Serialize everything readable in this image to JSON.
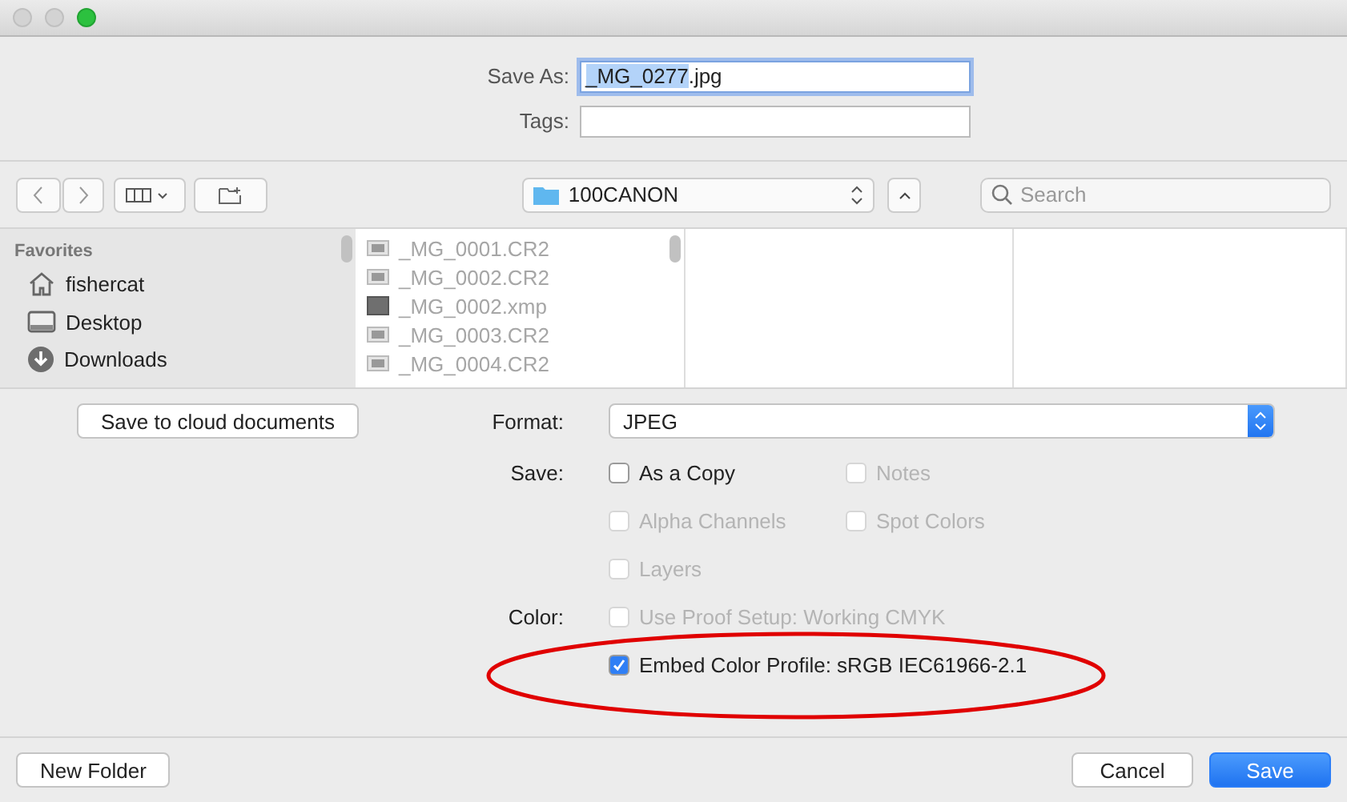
{
  "save_as": {
    "label": "Save As:",
    "selected_text": "_MG_0277",
    "unselected_text": ".jpg"
  },
  "tags": {
    "label": "Tags:"
  },
  "location": {
    "folder": "100CANON"
  },
  "search": {
    "placeholder": "Search"
  },
  "sidebar": {
    "heading": "Favorites",
    "items": [
      {
        "label": "fishercat",
        "kind": "home"
      },
      {
        "label": "Desktop",
        "kind": "desktop"
      },
      {
        "label": "Downloads",
        "kind": "downloads"
      }
    ]
  },
  "files": [
    {
      "name": "_MG_0001.CR2",
      "kind": "raw",
      "disabled": true
    },
    {
      "name": "_MG_0002.CR2",
      "kind": "raw",
      "disabled": true
    },
    {
      "name": "_MG_0002.xmp",
      "kind": "xmp",
      "disabled": true
    },
    {
      "name": "_MG_0003.CR2",
      "kind": "raw",
      "disabled": true
    },
    {
      "name": "_MG_0004.CR2",
      "kind": "raw",
      "disabled": true
    }
  ],
  "cloud_button": "Save to cloud documents",
  "format": {
    "label": "Format:",
    "value": "JPEG"
  },
  "save_options": {
    "label": "Save:",
    "items": [
      {
        "label": "As a Copy",
        "checked": false,
        "disabled": false
      },
      {
        "label": "Notes",
        "checked": false,
        "disabled": true
      },
      {
        "label": "Alpha Channels",
        "checked": false,
        "disabled": true
      },
      {
        "label": "Spot Colors",
        "checked": false,
        "disabled": true
      },
      {
        "label": "Layers",
        "checked": false,
        "disabled": true
      }
    ]
  },
  "color_options": {
    "label": "Color:",
    "items": [
      {
        "label": "Use Proof Setup:  Working CMYK",
        "checked": false,
        "disabled": true
      },
      {
        "label": "Embed Color Profile:  sRGB IEC61966-2.1",
        "checked": true,
        "disabled": false
      }
    ]
  },
  "buttons": [
    {
      "label": "New Folder",
      "kind": "plain"
    },
    {
      "label": "Cancel",
      "kind": "plain"
    },
    {
      "label": "Save",
      "kind": "primary"
    }
  ]
}
